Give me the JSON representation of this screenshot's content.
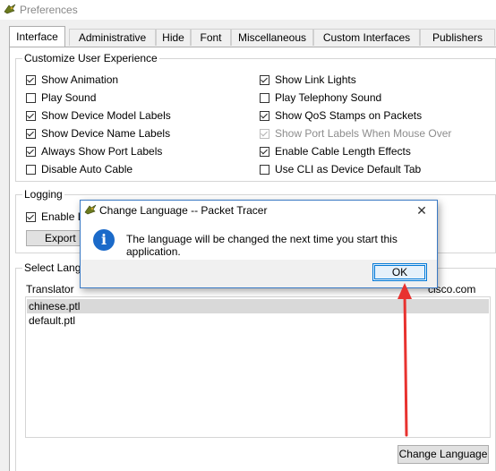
{
  "window": {
    "title": "Preferences",
    "icon": "packet-tracer-icon"
  },
  "tabs": [
    {
      "label": "Interface",
      "active": true
    },
    {
      "label": "Administrative"
    },
    {
      "label": "Hide"
    },
    {
      "label": "Font"
    },
    {
      "label": "Miscellaneous"
    },
    {
      "label": "Custom Interfaces"
    },
    {
      "label": "Publishers"
    }
  ],
  "customize": {
    "title": "Customize User Experience",
    "left": [
      {
        "label": "Show Animation",
        "checked": true
      },
      {
        "label": "Play Sound",
        "checked": false
      },
      {
        "label": "Show Device Model Labels",
        "checked": true
      },
      {
        "label": "Show Device Name Labels",
        "checked": true
      },
      {
        "label": "Always Show Port Labels",
        "checked": true
      },
      {
        "label": "Disable Auto Cable",
        "checked": false
      }
    ],
    "right": [
      {
        "label": "Show Link Lights",
        "checked": true
      },
      {
        "label": "Play Telephony Sound",
        "checked": false
      },
      {
        "label": "Show QoS Stamps on Packets",
        "checked": true
      },
      {
        "label": "Show Port Labels When Mouse Over",
        "checked": true,
        "disabled": true
      },
      {
        "label": "Enable Cable Length Effects",
        "checked": true
      },
      {
        "label": "Use CLI as Device Default Tab",
        "checked": false
      }
    ]
  },
  "logging": {
    "title": "Logging",
    "enable_label": "Enable L",
    "enable_checked": true,
    "export_label": "Export L"
  },
  "language": {
    "title": "Select Langu",
    "columns": [
      "Translator",
      "cisco.com"
    ],
    "files": [
      {
        "name": "chinese.ptl",
        "selected": true
      },
      {
        "name": "default.ptl",
        "selected": false
      }
    ],
    "change_button": "Change Language"
  },
  "dialog": {
    "title": "Change Language -- Packet Tracer",
    "message": "The language will be changed the next time you start this application.",
    "ok_label": "OK",
    "close_glyph": "✕",
    "info_glyph": "i"
  },
  "annotation": {
    "arrow_color": "#e8322f"
  }
}
